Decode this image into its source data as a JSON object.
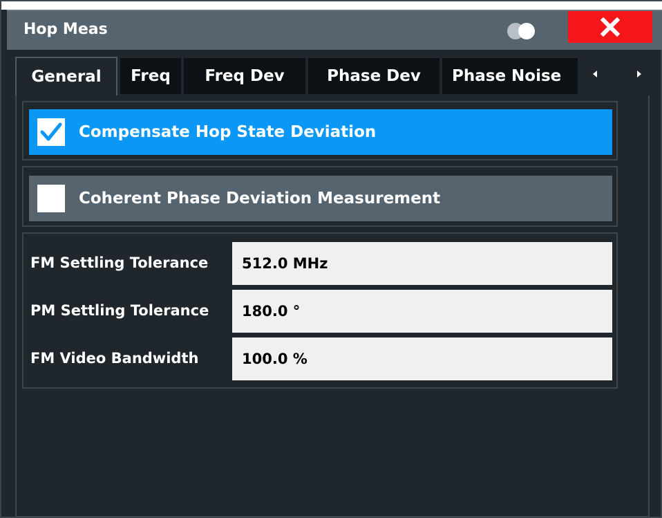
{
  "dialog": {
    "title": "Hop Meas",
    "close_icon": "close-icon",
    "toggle_icon": "transparency-toggle-icon"
  },
  "tabs": [
    {
      "label": "General",
      "active": true
    },
    {
      "label": "Freq",
      "active": false
    },
    {
      "label": "Freq Dev",
      "active": false
    },
    {
      "label": "Phase Dev",
      "active": false
    },
    {
      "label": "Phase Noise",
      "active": false
    }
  ],
  "tab_scroll": {
    "left_icon": "scroll-left-icon",
    "right_icon": "scroll-right-icon"
  },
  "options": {
    "compensate": {
      "label": "Compensate Hop State Deviation",
      "checked": true
    },
    "coherent": {
      "label": "Coherent Phase Deviation Measurement",
      "checked": false
    }
  },
  "fields": [
    {
      "label": "FM Settling Tolerance",
      "value": "512.0 MHz"
    },
    {
      "label": "PM Settling Tolerance",
      "value": "180.0 °"
    },
    {
      "label": "FM Video Bandwidth",
      "value": "100.0 %"
    }
  ],
  "colors": {
    "accent": "#0a97f5",
    "close": "#f4161a",
    "titlebar": "#56646f",
    "background": "#1f262c"
  }
}
